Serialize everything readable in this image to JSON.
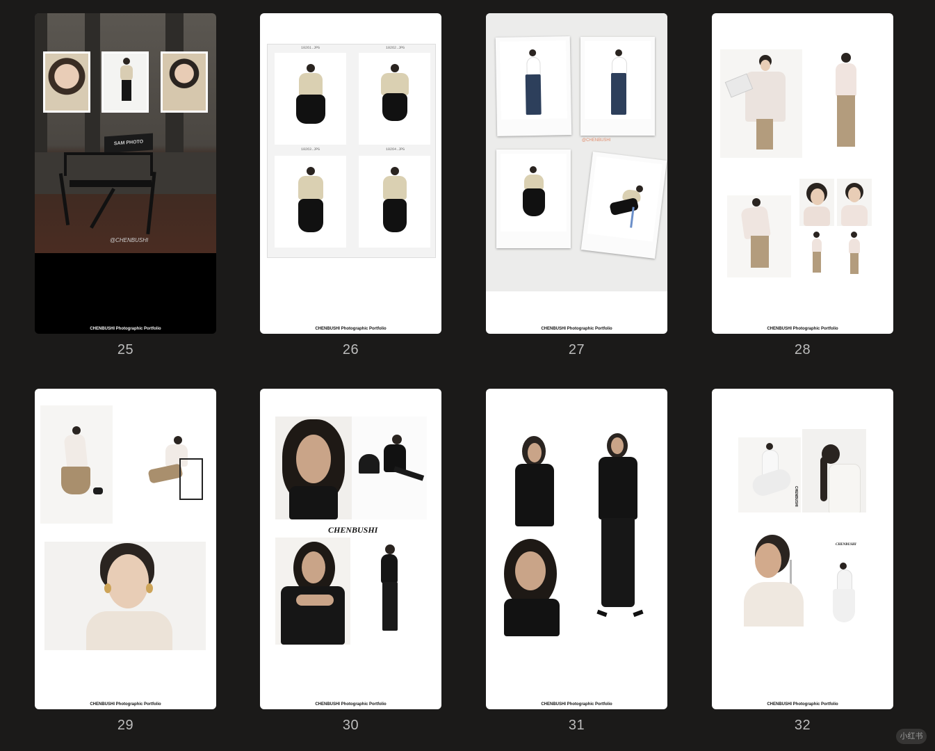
{
  "portfolio": {
    "footer_text": "CHENBUSHI Photographic Portfolio",
    "brand": "CHENBUSHI",
    "chair_text": "SAM PHOTO",
    "chair_caption": "@CHENBUSHI",
    "side_text": "CHENBUSHI",
    "file_labels": [
      "10261.JPG",
      "10262.JPG",
      "10263.JPG",
      "10264.JPG"
    ]
  },
  "pages": [
    {
      "number": "25"
    },
    {
      "number": "26"
    },
    {
      "number": "27"
    },
    {
      "number": "28"
    },
    {
      "number": "29"
    },
    {
      "number": "30"
    },
    {
      "number": "31"
    },
    {
      "number": "32"
    }
  ],
  "watermark": "小红书"
}
